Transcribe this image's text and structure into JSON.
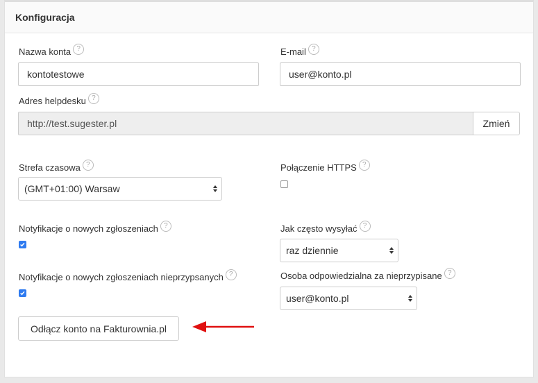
{
  "panel": {
    "title": "Konfiguracja"
  },
  "fields": {
    "account_name": {
      "label": "Nazwa konta",
      "value": "kontotestowe"
    },
    "email": {
      "label": "E-mail",
      "value": "user@konto.pl"
    },
    "helpdesk": {
      "label": "Adres helpdesku",
      "value": "http://test.sugester.pl",
      "change_button": "Zmień"
    },
    "timezone": {
      "label": "Strefa czasowa",
      "value": "(GMT+01:00) Warsaw"
    },
    "https": {
      "label": "Połączenie HTTPS",
      "checked": false
    },
    "notify_new": {
      "label": "Notyfikacje o nowych zgłoszeniach",
      "checked": true
    },
    "frequency": {
      "label": "Jak często wysyłać",
      "value": "raz dziennie"
    },
    "notify_unassigned": {
      "label": "Notyfikacje o nowych zgłoszeniach nieprzypsanych",
      "checked": true
    },
    "responsible": {
      "label": "Osoba odpowiedzialna za nieprzypisane",
      "value": "user@konto.pl"
    }
  },
  "disconnect_button": "Odłącz konto na Fakturownia.pl",
  "help_glyph": "?",
  "colors": {
    "checkbox_checked": "#2f7bf0",
    "arrow": "#e01010"
  }
}
